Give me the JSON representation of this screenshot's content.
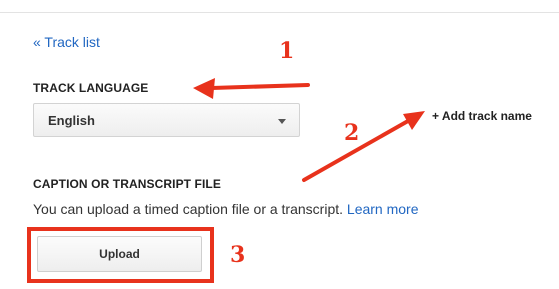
{
  "nav": {
    "back_link": "« Track list"
  },
  "track_language": {
    "heading": "TRACK LANGUAGE",
    "selected": "English"
  },
  "add_track_name": "+ Add track name",
  "caption_file": {
    "heading": "CAPTION OR TRANSCRIPT FILE",
    "description": "You can upload a timed caption file or a transcript.",
    "learn_more": "Learn more",
    "upload_label": "Upload"
  },
  "annotations": {
    "numbers": [
      "1",
      "2",
      "3"
    ],
    "color": "#e8321c"
  },
  "colors": {
    "link": "#2167c2",
    "annotation": "#e8321c"
  },
  "icons": [
    "chevron-down-icon",
    "arrow-icon"
  ]
}
